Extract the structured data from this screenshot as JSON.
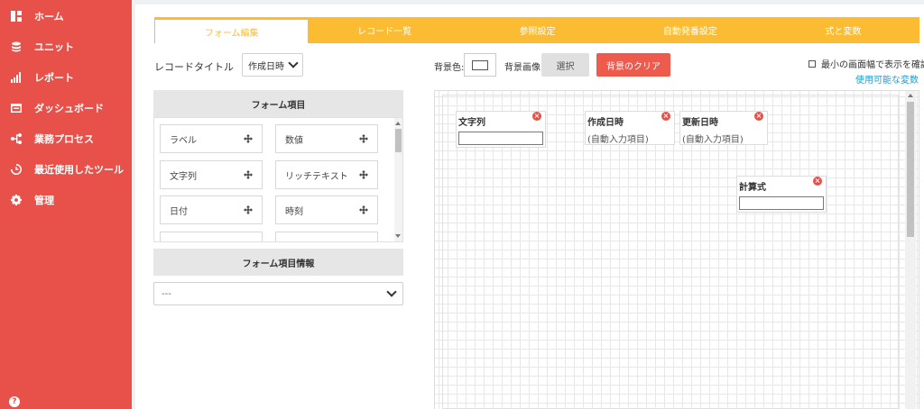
{
  "sidebar": {
    "items": [
      {
        "label": "ホーム",
        "icon": "home-icon"
      },
      {
        "label": "ユニット",
        "icon": "database-icon"
      },
      {
        "label": "レポート",
        "icon": "chart-icon"
      },
      {
        "label": "ダッシュボード",
        "icon": "dashboard-icon"
      },
      {
        "label": "業務プロセス",
        "icon": "process-icon"
      },
      {
        "label": "最近使用したツール",
        "icon": "history-icon"
      },
      {
        "label": "管理",
        "icon": "gear-icon"
      }
    ],
    "help": "?"
  },
  "tabs": [
    "フォーム編集",
    "レコード一覧",
    "参照設定",
    "自動発番設定",
    "式と変数"
  ],
  "toolbar": {
    "record_title_label": "レコードタイトル",
    "record_title_value": "作成日時",
    "bgcolor_label": "背景色:",
    "bgimage_label": "背景画像:",
    "select_button": "選択",
    "clear_button": "背景のクリア",
    "min_width_label": "最小の画面幅で表示を確認",
    "vars_link": "使用可能な変数"
  },
  "left_panel": {
    "form_items_header": "フォーム項目",
    "form_items": [
      "ラベル",
      "数値",
      "文字列",
      "リッチテキスト",
      "日付",
      "時刻"
    ],
    "form_item_info_header": "フォーム項目情報",
    "info_select_value": "---"
  },
  "canvas": {
    "fields": [
      {
        "label": "文字列",
        "type": "input"
      },
      {
        "label": "作成日時",
        "type": "auto",
        "text": "(自動入力項目)"
      },
      {
        "label": "更新日時",
        "type": "auto",
        "text": "(自動入力項目)"
      },
      {
        "label": "計算式",
        "type": "input"
      }
    ]
  },
  "colors": {
    "sidebar": "#e8514a",
    "tabs": "#fbbc33",
    "clear_button": "#ee5b4d",
    "link": "#1d9ad6"
  }
}
